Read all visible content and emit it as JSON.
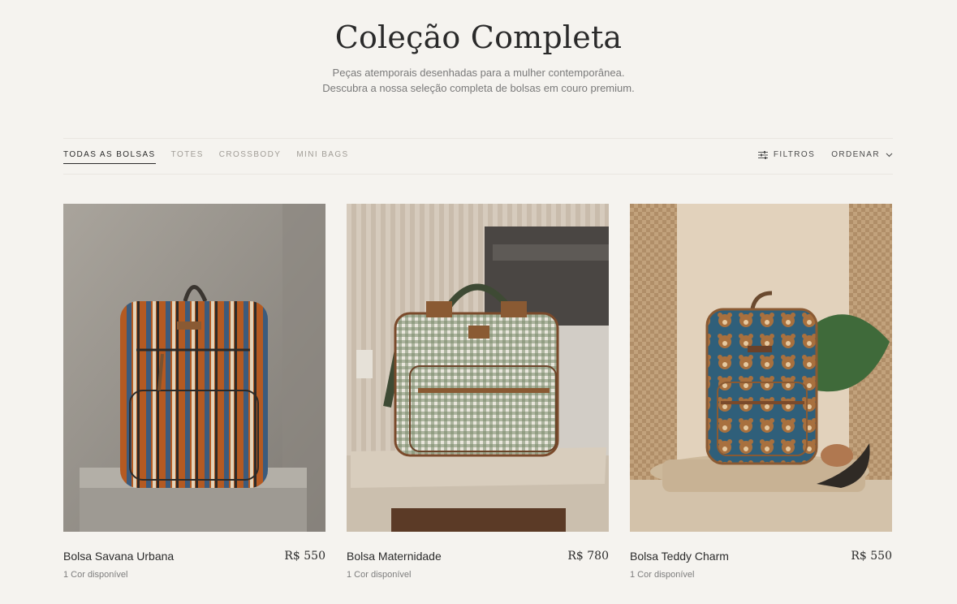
{
  "hero": {
    "title": "Coleção Completa",
    "subtitle_line1": "Peças atemporais desenhadas para a mulher contemporânea.",
    "subtitle_line2": "Descubra a nossa seleção completa de bolsas em couro premium."
  },
  "tabs": [
    {
      "label": "TODAS AS BOLSAS",
      "active": true
    },
    {
      "label": "TOTES",
      "active": false
    },
    {
      "label": "CROSSBODY",
      "active": false
    },
    {
      "label": "MINI BAGS",
      "active": false
    }
  ],
  "actions": {
    "filters_label": "FILTROS",
    "filters_icon": "sliders-icon",
    "sort_label": "ORDENAR",
    "sort_icon": "chevron-down-icon"
  },
  "products": [
    {
      "name": "Bolsa Savana Urbana",
      "price": "R$ 550",
      "colors": "1 Cor disponível"
    },
    {
      "name": "Bolsa Maternidade",
      "price": "R$ 780",
      "colors": "1 Cor disponível"
    },
    {
      "name": "Bolsa Teddy Charm",
      "price": "R$ 550",
      "colors": "1 Cor disponível"
    }
  ],
  "theme": {
    "background": "#f5f3ef",
    "text": "#2b2b2b",
    "muted": "#7a7a7a"
  }
}
